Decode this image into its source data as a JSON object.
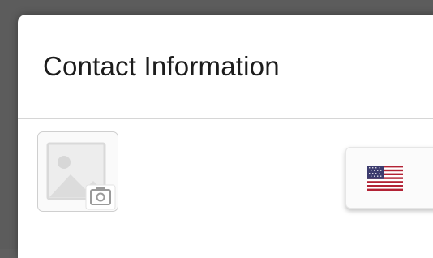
{
  "dialog": {
    "title": "Contact Information"
  },
  "photo": {
    "icon": "image-placeholder-icon",
    "badge_icon": "camera-icon"
  },
  "country_selector": {
    "flag_icon": "us-flag-icon"
  },
  "colors": {
    "backdrop": "#5c5c5c",
    "surface": "#ffffff",
    "divider": "#d6d6d6",
    "title_text": "#1c1c1c",
    "placeholder_gray": "#d9d9d9",
    "flag_red": "#b22234",
    "flag_blue": "#3c3b6e"
  }
}
